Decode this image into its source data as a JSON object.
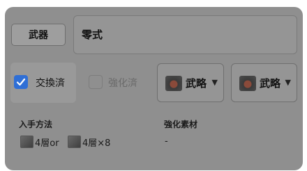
{
  "weapon_button": {
    "label": "武器"
  },
  "name_field": {
    "value": "零式"
  },
  "checkboxes": [
    {
      "label": "交換済",
      "checked": true
    },
    {
      "label": "強化済",
      "checked": false
    }
  ],
  "selects": [
    {
      "value": "武略",
      "icon": "strategy-icon"
    },
    {
      "value": "武略",
      "icon": "strategy-icon"
    }
  ],
  "acquisition": {
    "label": "入手方法",
    "items": [
      {
        "icon": "item-icon",
        "text": "4層or"
      },
      {
        "icon": "item-icon",
        "text": "4層×8"
      }
    ]
  },
  "materials": {
    "label": "強化素材",
    "value": "-"
  },
  "colors": {
    "accent": "#2f6fd6",
    "overlay": "#8f8f8f"
  }
}
